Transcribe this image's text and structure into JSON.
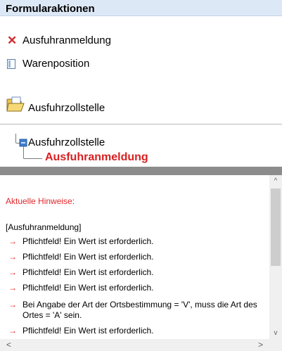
{
  "panel": {
    "title": "Formularaktionen"
  },
  "actions": [
    {
      "label": "Ausfuhranmeldung",
      "icon": "close-x-icon"
    },
    {
      "label": "Warenposition",
      "icon": "document-icon"
    }
  ],
  "folder": {
    "label": "Ausfuhrzollstelle",
    "icon": "open-folder-icon"
  },
  "tree": {
    "root": "Ausfuhrzollstelle",
    "child": "Ausfuhranmeldung"
  },
  "messages": {
    "title": "Aktuelle Hinweise:",
    "group": "[Ausfuhranmeldung]",
    "items": [
      "Pflichtfeld! Ein Wert ist erforderlich.",
      "Pflichtfeld! Ein Wert ist erforderlich.",
      "Pflichtfeld! Ein Wert ist erforderlich.",
      "Pflichtfeld! Ein Wert ist erforderlich.",
      "Bei Angabe der Art der Ortsbestimmung = 'V', muss die Art des Ortes = 'A' sein.",
      "Pflichtfeld! Ein Wert ist erforderlich."
    ],
    "arrow": "→"
  },
  "scrollbar": {
    "up": "^",
    "down": "v",
    "left": "<",
    "right": ">"
  },
  "colors": {
    "header_bg": "#dde8f6",
    "error_red": "#d92020",
    "separator_gray": "#8c8c8c"
  }
}
